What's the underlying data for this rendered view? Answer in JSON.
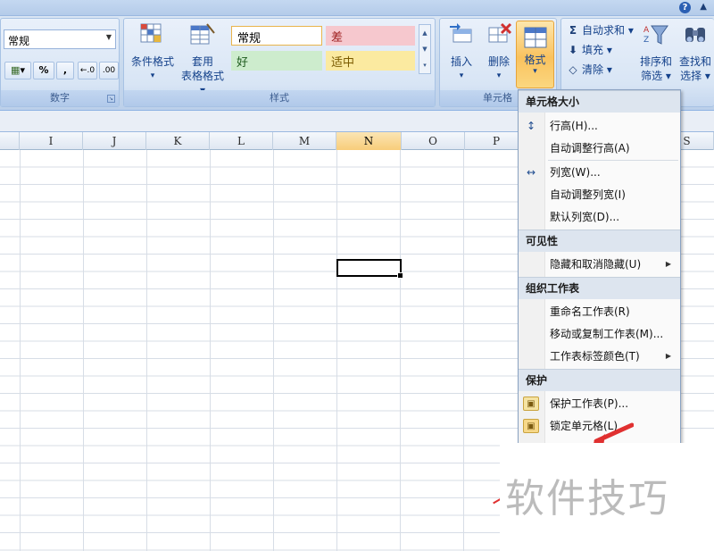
{
  "ribbon": {
    "number_group": {
      "label": "数字",
      "format_value": "常规",
      "buttons": [
        "%",
        ","
      ]
    },
    "styles_group": {
      "label": "样式",
      "conditional_format": {
        "line1": "条件格式",
        "line2": "▾"
      },
      "format_as_table": {
        "line1": "套用",
        "line2": "表格格式 ▾"
      },
      "cell_styles": [
        {
          "label": "常规",
          "bg": "#ffffff"
        },
        {
          "label": "差",
          "bg": "#f6c8ce"
        },
        {
          "label": "好",
          "bg": "#cdeccd"
        },
        {
          "label": "适中",
          "bg": "#fbeaa0"
        }
      ]
    },
    "cells_group": {
      "label": "单元格",
      "insert": {
        "line1": "插入",
        "line2": "▾"
      },
      "delete": {
        "line1": "删除",
        "line2": "▾"
      },
      "format": {
        "line1": "格式",
        "line2": "▾"
      }
    },
    "editing_group": {
      "autosum": "自动求和 ▾",
      "fill": "填充 ▾",
      "clear": "清除 ▾",
      "sort_filter": {
        "line1": "排序和",
        "line2": "筛选 ▾"
      },
      "find_select": {
        "line1": "查找和",
        "line2": "选择 ▾"
      }
    }
  },
  "columns": [
    {
      "label": "I",
      "selected": false
    },
    {
      "label": "J",
      "selected": false
    },
    {
      "label": "K",
      "selected": false
    },
    {
      "label": "L",
      "selected": false
    },
    {
      "label": "M",
      "selected": false
    },
    {
      "label": "N",
      "selected": true
    },
    {
      "label": "O",
      "selected": false
    },
    {
      "label": "P",
      "selected": false
    },
    {
      "label": "S",
      "selected": false
    }
  ],
  "menu": {
    "sections": [
      {
        "header": "单元格大小",
        "items": [
          {
            "label": "行高(H)...",
            "icon": "row-height-icon",
            "glyph": "↕",
            "submenu": false
          },
          {
            "label": "自动调整行高(A)",
            "icon": "",
            "glyph": "",
            "submenu": false
          },
          {
            "label": "列宽(W)...",
            "icon": "column-width-icon",
            "glyph": "↔",
            "submenu": false
          },
          {
            "label": "自动调整列宽(I)",
            "icon": "",
            "glyph": "",
            "submenu": false
          },
          {
            "label": "默认列宽(D)...",
            "icon": "",
            "glyph": "",
            "submenu": false
          }
        ]
      },
      {
        "header": "可见性",
        "items": [
          {
            "label": "隐藏和取消隐藏(U)",
            "icon": "",
            "glyph": "",
            "submenu": true
          }
        ]
      },
      {
        "header": "组织工作表",
        "items": [
          {
            "label": "重命名工作表(R)",
            "icon": "",
            "glyph": "",
            "submenu": false
          },
          {
            "label": "移动或复制工作表(M)...",
            "icon": "",
            "glyph": "",
            "submenu": false
          },
          {
            "label": "工作表标签颜色(T)",
            "icon": "",
            "glyph": "",
            "submenu": true
          }
        ]
      },
      {
        "header": "保护",
        "items": [
          {
            "label": "保护工作表(P)...",
            "icon": "protect-sheet-icon",
            "glyph": "🔒",
            "submenu": false
          },
          {
            "label": "锁定单元格(L)",
            "icon": "lock-cell-icon",
            "glyph": "🔒",
            "submenu": false
          }
        ]
      }
    ]
  },
  "watermark": "软件技巧",
  "colors": {
    "accent": "#f9c25e",
    "arrow": "#e03030",
    "ribbon": "#c9daee"
  }
}
